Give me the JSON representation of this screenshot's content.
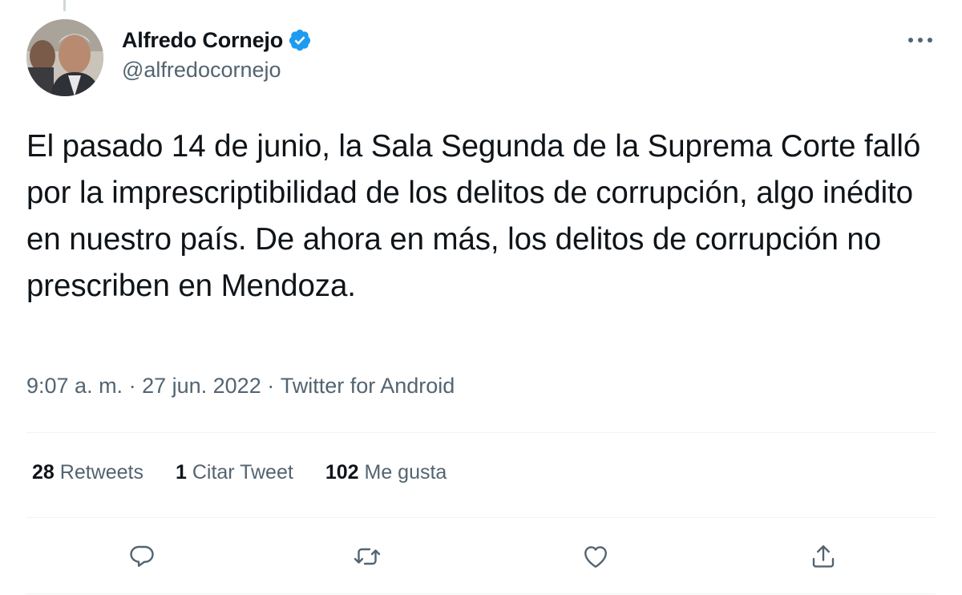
{
  "author": {
    "display_name": "Alfredo Cornejo",
    "handle": "@alfredocornejo",
    "verified_icon": "verified-badge-icon"
  },
  "tweet": {
    "text": "El pasado 14 de junio, la Sala Segunda de la Suprema Corte falló por la imprescriptibilidad de los delitos de corrupción, algo inédito en nuestro país. De ahora en más, los delitos de corrupción no prescriben en Mendoza.",
    "time": "9:07 a. m.",
    "separator": " · ",
    "date": "27 jun. 2022",
    "source": "Twitter for Android"
  },
  "stats": {
    "retweets_count": "28",
    "retweets_label": " Retweets",
    "quotes_count": "1",
    "quotes_label": " Citar Tweet",
    "likes_count": "102",
    "likes_label": " Me gusta"
  },
  "actions": [
    "reply-icon",
    "retweet-icon",
    "like-icon",
    "share-icon"
  ],
  "colors": {
    "text_primary": "#0f1419",
    "text_secondary": "#536471",
    "verified_blue": "#1d9bf0",
    "divider": "#eff3f4"
  }
}
